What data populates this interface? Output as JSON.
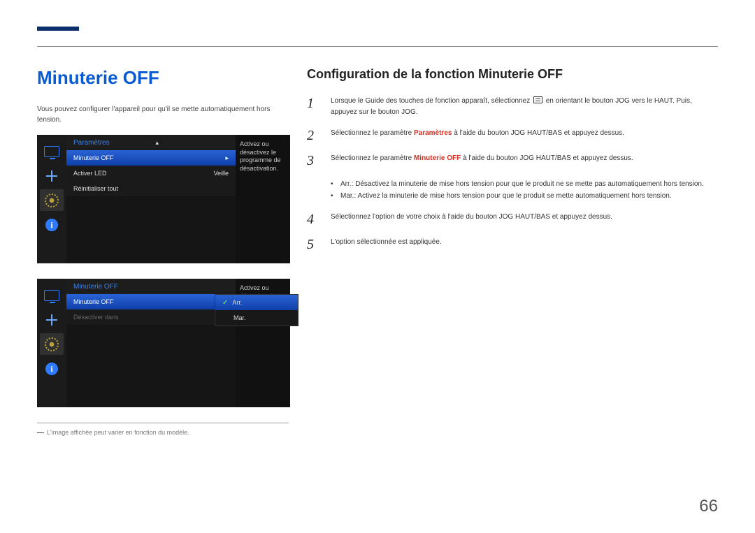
{
  "page_number": "66",
  "heading": "Minuterie OFF",
  "intro": "Vous pouvez configurer l'appareil pour qu'il se mette automatiquement hors tension.",
  "footnote": "L'image affichée peut varier en fonction du modèle.",
  "subheading": "Configuration de la fonction Minuterie OFF",
  "osd1": {
    "title": "Paramètres",
    "rows": [
      {
        "label": "Minuterie OFF",
        "value": "",
        "selected": true,
        "caret": "▸"
      },
      {
        "label": "Activer LED",
        "value": "Veille",
        "selected": false
      },
      {
        "label": "Réinitialiser tout",
        "value": "",
        "selected": false
      }
    ],
    "desc": "Activez ou désactivez le programme de désactivation."
  },
  "osd2": {
    "title": "Minuterie OFF",
    "rows": [
      {
        "label": "Minuterie OFF",
        "selected": true
      },
      {
        "label": "Désactiver dans",
        "selected": false,
        "disabled": true
      }
    ],
    "submenu": [
      {
        "label": "Arr.",
        "selected": true,
        "checked": true
      },
      {
        "label": "Mar.",
        "selected": false
      }
    ],
    "desc": "Activez ou désactivez le programme de désactivation."
  },
  "steps": {
    "s1a": "Lorsque le Guide des touches de fonction apparaît, sélectionnez ",
    "s1b": " en orientant le bouton JOG vers le HAUT. Puis, appuyez sur le bouton JOG.",
    "s2a": "Sélectionnez le paramètre ",
    "s2_em": "Paramètres",
    "s2b": " à l'aide du bouton JOG HAUT/BAS et appuyez dessus.",
    "s3a": "Sélectionnez le paramètre ",
    "s3_em": "Minuterie OFF",
    "s3b": " à l'aide du bouton JOG HAUT/BAS et appuyez dessus.",
    "b1_em": "Arr.",
    "b1": ": Désactivez la minuterie de mise hors tension pour que le produit ne se mette pas automatiquement hors tension.",
    "b2_em": "Mar.",
    "b2": ": Activez la minuterie de mise hors tension pour que le produit se mette automatiquement hors tension.",
    "s4": "Sélectionnez l'option de votre choix à l'aide du bouton JOG HAUT/BAS et appuyez dessus.",
    "s5": "L'option sélectionnée est appliquée."
  },
  "nums": {
    "n1": "1",
    "n2": "2",
    "n3": "3",
    "n4": "4",
    "n5": "5"
  }
}
